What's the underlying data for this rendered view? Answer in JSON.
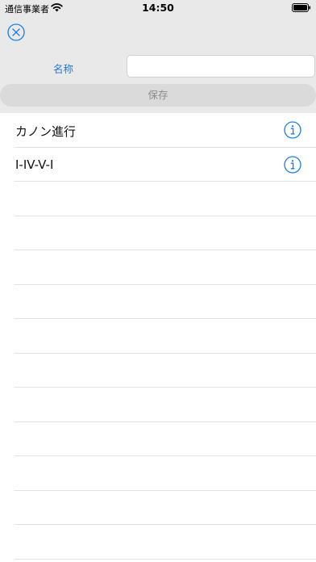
{
  "status_bar": {
    "carrier": "通信事業者",
    "time": "14:50"
  },
  "form": {
    "name_label": "名称",
    "name_value": "",
    "save_label": "保存"
  },
  "items": [
    {
      "label": "カノン進行"
    },
    {
      "label": "I-IV-V-I"
    }
  ],
  "colors": {
    "accent": "#1a7ce0",
    "header_bg": "#e9e9e9"
  }
}
